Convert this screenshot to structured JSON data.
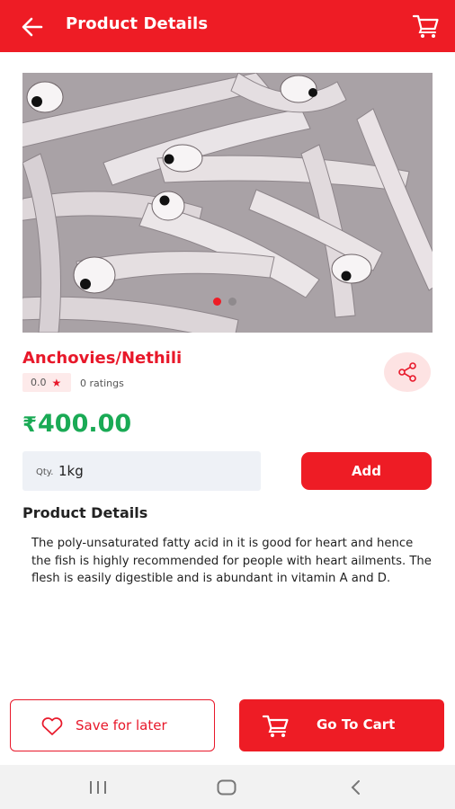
{
  "header": {
    "title": "Product Details",
    "back_icon": "arrow-left-icon",
    "cart_icon": "cart-icon"
  },
  "product": {
    "name": "Anchovies/Nethili",
    "rating": "0.0",
    "ratings_count": "0 ratings",
    "currency": "₹",
    "price": "400.00",
    "image_slides": 2,
    "active_slide": 1
  },
  "quantity": {
    "label": "Qty.",
    "value": "1kg"
  },
  "add_button": "Add",
  "details": {
    "title": "Product Details",
    "text": "The poly-unsaturated fatty acid in it is good for heart and hence the fish is highly recommended for people with heart ailments. The flesh is easily digestible and is abundant in vitamin A and D."
  },
  "footer": {
    "save_label": "Save for later",
    "cart_label": "Go To Cart"
  },
  "colors": {
    "primary": "#ee1c25",
    "price": "#1aaa55",
    "share_bg": "#fde3e3"
  }
}
